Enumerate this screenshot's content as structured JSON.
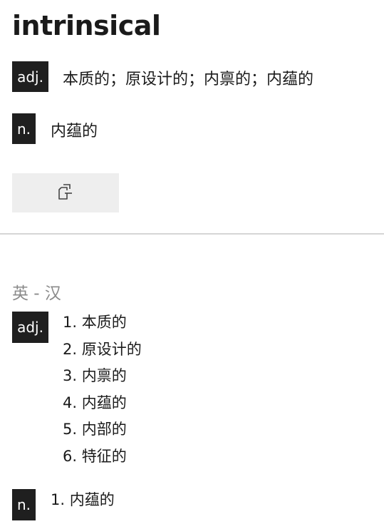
{
  "headword": "intrinsical",
  "brief": [
    {
      "pos": "adj.",
      "text": "本质的；原设计的；内禀的；内蕴的"
    },
    {
      "pos": "n.",
      "text": "内蕴的"
    }
  ],
  "copy_button": {
    "icon": "copy-icon"
  },
  "section": {
    "title": "英 - 汉",
    "entries": [
      {
        "pos": "adj.",
        "senses": [
          "1. 本质的",
          "2. 原设计的",
          "3. 内禀的",
          "4. 内蕴的",
          "5. 内部的",
          "6. 特征的"
        ]
      },
      {
        "pos": "n.",
        "senses": [
          "1. 内蕴的"
        ]
      }
    ]
  },
  "colors": {
    "tag_bg": "#1f1f1f",
    "button_bg": "#eeeeee",
    "muted_text": "#8a8a8a",
    "divider": "#d6d6d6"
  }
}
